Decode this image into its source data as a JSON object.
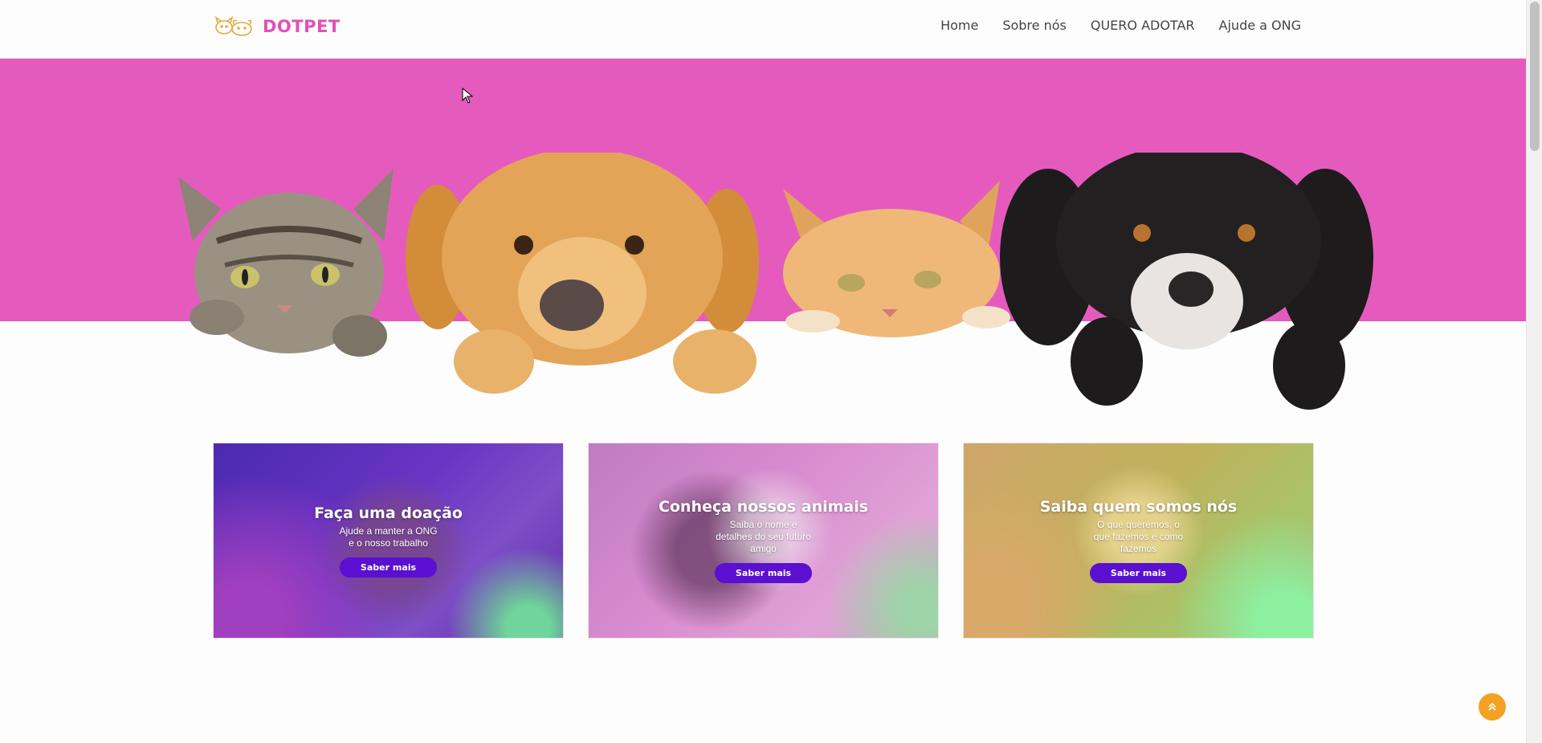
{
  "brand": {
    "name": "DOTPET",
    "logo_icon": "pets-outline-logo",
    "color": "#e24fb7"
  },
  "nav": {
    "items": [
      {
        "label": "Home"
      },
      {
        "label": "Sobre nós"
      },
      {
        "label": "QUERO ADOTAR"
      },
      {
        "label": "Ajude a ONG"
      }
    ]
  },
  "hero": {
    "background": "#e55bbd",
    "image": "cats-and-dogs-peeking-over-edge"
  },
  "cards": [
    {
      "title": "Faça uma doação",
      "text": "Ajude a manter a ONG\ne o nosso trabalho",
      "button": "Saber mais"
    },
    {
      "title": "Conheça nossos animais",
      "text": "Saiba o nome e\ndetalhes do seu futuro\namigo",
      "button": "Saber mais"
    },
    {
      "title": "Saiba quem somos nós",
      "text": "O que queremos, o\nque fazemos e como\nfazemos",
      "button": "Saber mais"
    }
  ],
  "back_to_top": {
    "icon": "double-chevron-up-icon",
    "color": "#f3a125"
  },
  "accent": "#5a0fd1"
}
